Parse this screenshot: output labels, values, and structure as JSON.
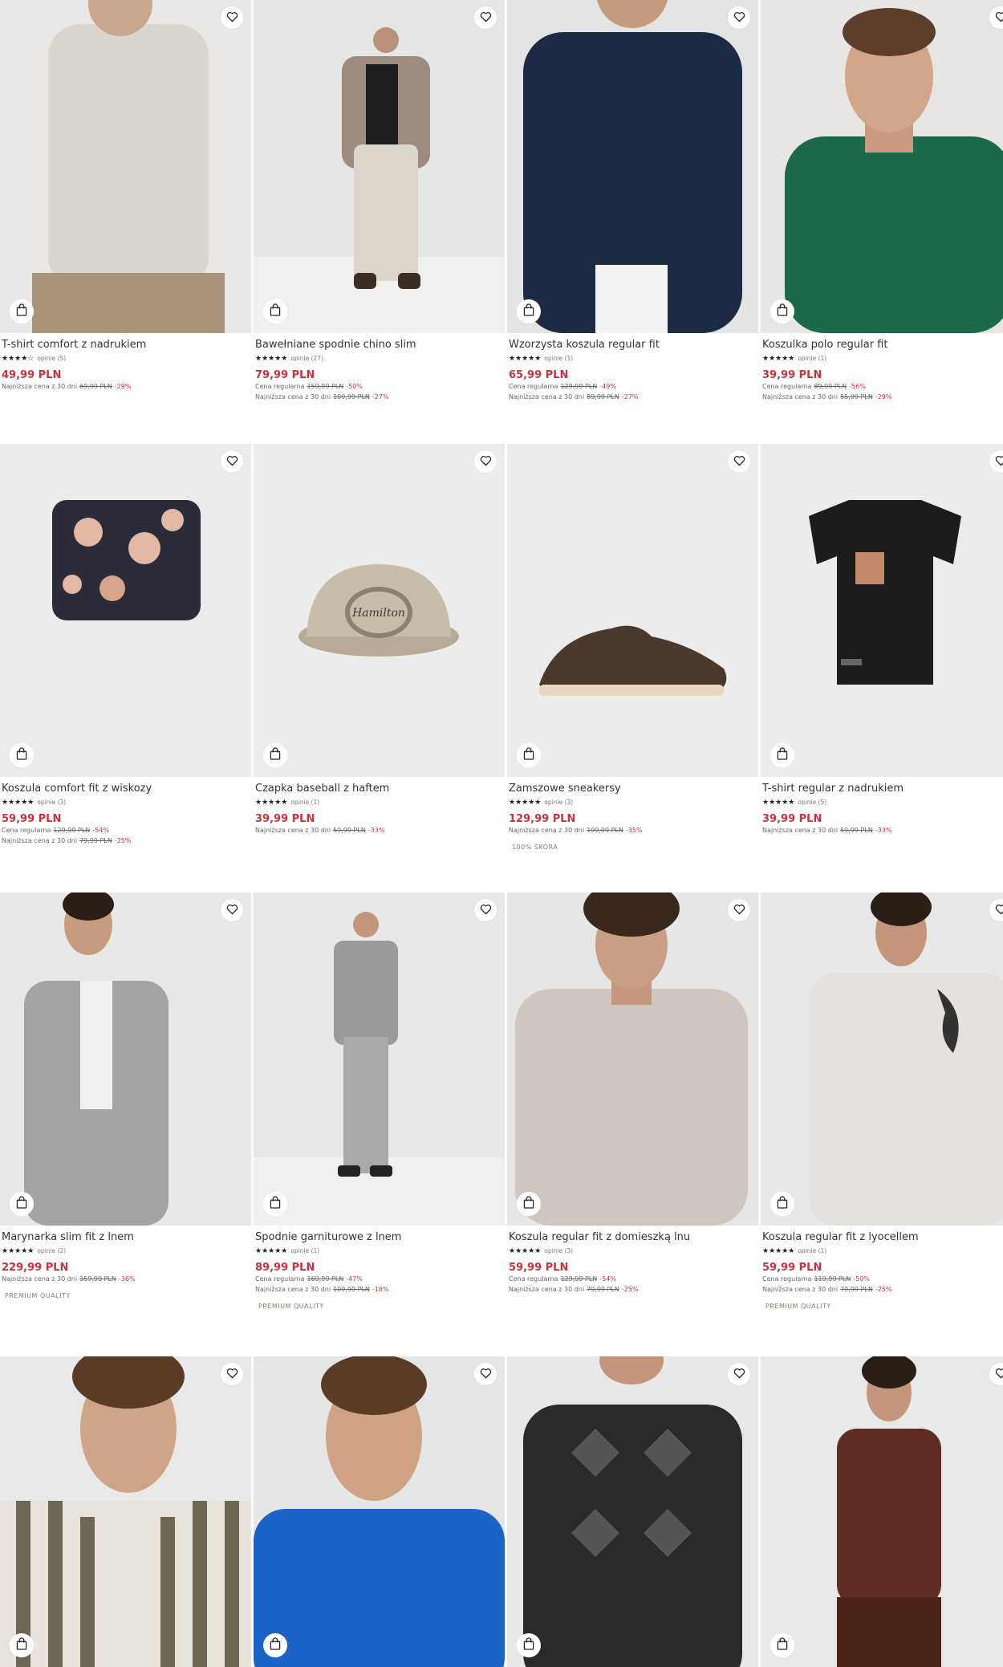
{
  "products": [
    {
      "name": "T-shirt comfort z nadrukiem",
      "stars": "★★★★☆",
      "reviews": "opinie (5)",
      "price": "49,99 PLN",
      "regular": null,
      "lowest": {
        "label": "Najniższa cena z 30 dni",
        "old": "69,99 PLN",
        "discount": "-29%"
      },
      "tag": null,
      "bg": "#e9e8e6"
    },
    {
      "name": "Bawełniane spodnie chino slim",
      "stars": "★★★★★",
      "reviews": "opinie (27)",
      "price": "79,99 PLN",
      "regular": {
        "label": "Cena regularna",
        "old": "159,99 PLN",
        "discount": "-50%"
      },
      "lowest": {
        "label": "Najniższa cena z 30 dni",
        "old": "109,99 PLN",
        "discount": "-27%"
      },
      "tag": null,
      "bg": "#e6e6e6"
    },
    {
      "name": "Wzorzysta koszula regular fit",
      "stars": "★★★★★",
      "reviews": "opinie (1)",
      "price": "65,99 PLN",
      "regular": {
        "label": "Cena regularna",
        "old": "129,99 PLN",
        "discount": "-49%"
      },
      "lowest": {
        "label": "Najniższa cena z 30 dni",
        "old": "89,99 PLN",
        "discount": "-27%"
      },
      "tag": null,
      "bg": "#e4e4e4"
    },
    {
      "name": "Koszulka polo regular fit",
      "stars": "★★★★★",
      "reviews": "opinie (1)",
      "price": "39,99 PLN",
      "regular": {
        "label": "Cena regularna",
        "old": "89,99 PLN",
        "discount": "-56%"
      },
      "lowest": {
        "label": "Najniższa cena z 30 dni",
        "old": "55,99 PLN",
        "discount": "-29%"
      },
      "tag": null,
      "bg": "#e7e6e4"
    },
    {
      "name": "Koszula comfort fit z wiskozy",
      "stars": "★★★★★",
      "reviews": "opinie (3)",
      "price": "59,99 PLN",
      "regular": {
        "label": "Cena regularna",
        "old": "129,99 PLN",
        "discount": "-54%"
      },
      "lowest": {
        "label": "Najniższa cena z 30 dni",
        "old": "79,99 PLN",
        "discount": "-25%"
      },
      "tag": null,
      "bg": "#ebebeb"
    },
    {
      "name": "Czapka baseball z haftem",
      "stars": "★★★★★",
      "reviews": "opinie (1)",
      "price": "39,99 PLN",
      "regular": null,
      "lowest": {
        "label": "Najniższa cena z 30 dni",
        "old": "59,99 PLN",
        "discount": "-33%"
      },
      "tag": null,
      "bg": "#ececec"
    },
    {
      "name": "Zamszowe sneakersy",
      "stars": "★★★★★",
      "reviews": "opinie (3)",
      "price": "129,99 PLN",
      "regular": null,
      "lowest": {
        "label": "Najniższa cena z 30 dni",
        "old": "199,99 PLN",
        "discount": "-35%"
      },
      "tag": "100% SKÓRA",
      "bg": "#ececec"
    },
    {
      "name": "T-shirt regular z nadrukiem",
      "stars": "★★★★★",
      "reviews": "opinie (5)",
      "price": "39,99 PLN",
      "regular": null,
      "lowest": {
        "label": "Najniższa cena z 30 dni",
        "old": "59,99 PLN",
        "discount": "-33%"
      },
      "tag": null,
      "bg": "#ececec"
    },
    {
      "name": "Marynarka slim fit z lnem",
      "stars": "★★★★★",
      "reviews": "opinie (2)",
      "price": "229,99 PLN",
      "regular": null,
      "lowest": {
        "label": "Najniższa cena z 30 dni",
        "old": "359,99 PLN",
        "discount": "-36%"
      },
      "tag": "PREMIUM QUALITY",
      "bg": "#e8e8e8"
    },
    {
      "name": "Spodnie garniturowe z lnem",
      "stars": "★★★★★",
      "reviews": "opinie (1)",
      "price": "89,99 PLN",
      "regular": {
        "label": "Cena regularna",
        "old": "169,99 PLN",
        "discount": "-47%"
      },
      "lowest": {
        "label": "Najniższa cena z 30 dni",
        "old": "109,99 PLN",
        "discount": "-18%"
      },
      "tag": "PREMIUM QUALITY",
      "bg": "#e8e8e8"
    },
    {
      "name": "Koszula regular fit z domieszką lnu",
      "stars": "★★★★★",
      "reviews": "opinie (3)",
      "price": "59,99 PLN",
      "regular": {
        "label": "Cena regularna",
        "old": "129,99 PLN",
        "discount": "-54%"
      },
      "lowest": {
        "label": "Najniższa cena z 30 dni",
        "old": "79,99 PLN",
        "discount": "-25%"
      },
      "tag": null,
      "bg": "#e6e6e6"
    },
    {
      "name": "Koszula regular fit z lyocellem",
      "stars": "★★★★★",
      "reviews": "opinie (1)",
      "price": "59,99 PLN",
      "regular": {
        "label": "Cena regularna",
        "old": "119,99 PLN",
        "discount": "-50%"
      },
      "lowest": {
        "label": "Najniższa cena z 30 dni",
        "old": "79,99 PLN",
        "discount": "-25%"
      },
      "tag": "PREMIUM QUALITY",
      "bg": "#e8e8e8"
    },
    {
      "name": "",
      "stars": "",
      "reviews": "",
      "price": "",
      "regular": null,
      "lowest": null,
      "tag": null,
      "bg": "#e9e9e9"
    },
    {
      "name": "",
      "stars": "",
      "reviews": "",
      "price": "",
      "regular": null,
      "lowest": null,
      "tag": null,
      "bg": "#e6e6e6"
    },
    {
      "name": "",
      "stars": "",
      "reviews": "",
      "price": "",
      "regular": null,
      "lowest": null,
      "tag": null,
      "bg": "#e8e8e8"
    },
    {
      "name": "",
      "stars": "",
      "reviews": "",
      "price": "",
      "regular": null,
      "lowest": null,
      "tag": null,
      "bg": "#e9e9e9"
    }
  ],
  "colors": {
    "price": "#c8323c",
    "text": "#333333",
    "muted": "#666666"
  },
  "icons": {
    "favorite": "heart-icon",
    "cart": "shopping-bag-icon"
  }
}
